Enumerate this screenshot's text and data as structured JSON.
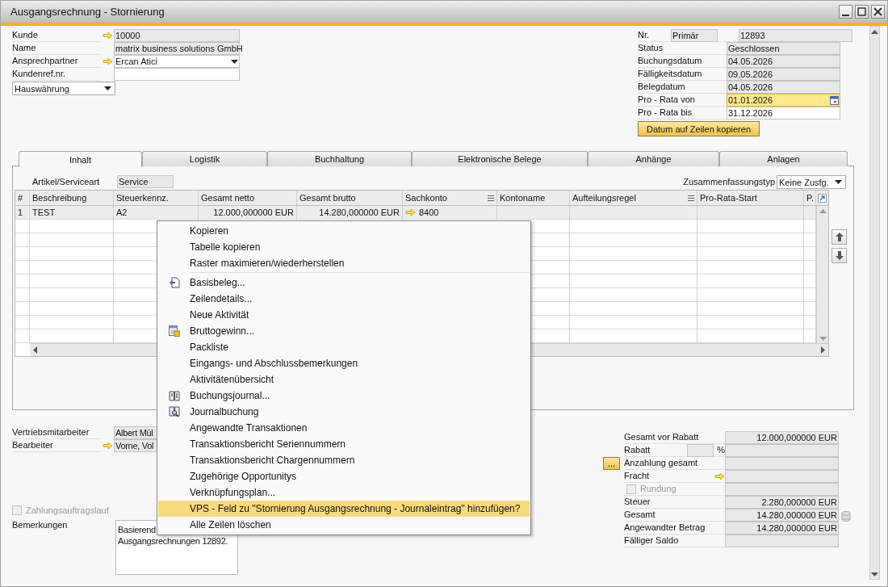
{
  "window": {
    "title": "Ausgangsrechnung - Stornierung"
  },
  "header_left": {
    "fields": [
      {
        "label": "Kunde",
        "value": "10000",
        "kind": "link",
        "editable": false
      },
      {
        "label": "Name",
        "value": "matrix business solutions GmbH",
        "kind": "plain",
        "editable": false
      },
      {
        "label": "Ansprechpartner",
        "value": "Ercan Atici",
        "kind": "link-dropdown",
        "editable": true
      },
      {
        "label": "Kundenref.nr.",
        "kind": "plain",
        "editable": true
      }
    ],
    "currency": {
      "value": "Hauswährung"
    }
  },
  "header_right": {
    "fields": [
      {
        "label": "Nr.",
        "series": "Primär",
        "value": "12893",
        "kind": "series",
        "editable": false,
        "focused": false
      },
      {
        "label": "Status",
        "value": "Geschlossen",
        "kind": "plain",
        "editable": false,
        "focused": false
      },
      {
        "label": "Buchungsdatum",
        "value": "04.05.2026",
        "kind": "plain",
        "editable": false,
        "focused": false
      },
      {
        "label": "Fälligkeitsdatum",
        "value": "09.05.2026",
        "kind": "plain",
        "editable": false,
        "focused": false
      },
      {
        "label": "Belegdatum",
        "value": "04.05.2026",
        "kind": "plain",
        "editable": false,
        "focused": false
      },
      {
        "label": "Pro - Rata von",
        "value": "01.01.2026",
        "kind": "date",
        "editable": true,
        "focused": true
      },
      {
        "label": "Pro - Rata bis",
        "value": "31.12.2026",
        "kind": "plain",
        "editable": true,
        "focused": false
      }
    ],
    "button": "Datum auf Zeilen kopieren"
  },
  "tabs": [
    {
      "label": "Inhalt",
      "selected": true
    },
    {
      "label": "Logistik",
      "selected": false
    },
    {
      "label": "Buchhaltung",
      "selected": false
    },
    {
      "label": "Elektronische Belege",
      "selected": false
    },
    {
      "label": "Anhänge",
      "selected": false
    },
    {
      "label": "Anlagen",
      "selected": false
    }
  ],
  "item_type": {
    "label": "Artikel/Serviceart",
    "value": "Service"
  },
  "summary_type": {
    "label": "Zusammenfassungstyp",
    "value": "Keine Zusfg."
  },
  "table": {
    "columns": [
      {
        "label": "#",
        "kind": "text"
      },
      {
        "label": "Beschreibung",
        "kind": "text"
      },
      {
        "label": "Steuerkennz.",
        "kind": "text"
      },
      {
        "label": "Gesamt netto",
        "kind": "amount"
      },
      {
        "label": "Gesamt brutto",
        "kind": "amount"
      },
      {
        "label": "Sachkonto",
        "kind": "account",
        "menu": true
      },
      {
        "label": "Kontoname",
        "kind": "text"
      },
      {
        "label": "Aufteilungsregel",
        "kind": "text",
        "menu": true
      },
      {
        "label": "Pro-Rata-Start",
        "kind": "text"
      },
      {
        "label": "P.",
        "kind": "text"
      }
    ],
    "rows": [
      {
        "cells": [
          "1",
          "TEST",
          "A2",
          "12.000,000000 EUR",
          "14.280,000000 EUR",
          "8400"
        ]
      }
    ]
  },
  "context_menu": {
    "sections": [
      [
        {
          "label": "Kopieren",
          "kind": "plain",
          "selected": false
        },
        {
          "label": "Tabelle kopieren",
          "kind": "plain",
          "selected": false
        },
        {
          "label": "Raster maximieren/wiederherstellen",
          "kind": "plain",
          "selected": false
        }
      ],
      [
        {
          "label": "Basisbeleg...",
          "kind": "icon",
          "selected": false
        },
        {
          "label": "Zeilendetails...",
          "kind": "plain",
          "selected": false
        },
        {
          "label": "Neue Aktivität",
          "kind": "plain",
          "selected": false
        },
        {
          "label": "Bruttogewinn...",
          "kind": "icon",
          "selected": false
        },
        {
          "label": "Packliste",
          "kind": "plain",
          "selected": false
        },
        {
          "label": "Eingangs- und Abschlussbemerkungen",
          "kind": "plain",
          "selected": false
        },
        {
          "label": "Aktivitätenübersicht",
          "kind": "plain",
          "selected": false
        },
        {
          "label": "Buchungsjournal...",
          "kind": "icon",
          "selected": false
        },
        {
          "label": "Journalbuchung",
          "kind": "icon",
          "selected": false
        },
        {
          "label": "Angewandte Transaktionen",
          "kind": "plain",
          "selected": false
        },
        {
          "label": "Transaktionsbericht Seriennummern",
          "kind": "plain",
          "selected": false
        },
        {
          "label": "Transaktionsbericht Chargennummern",
          "kind": "plain",
          "selected": false
        },
        {
          "label": "Zugehörige Opportunitys",
          "kind": "plain",
          "selected": false
        },
        {
          "label": "Verknüpfungsplan...",
          "kind": "plain",
          "selected": false
        },
        {
          "label": "VPS - Feld zu \"Stornierung Ausgangsrechnung - Journaleintrag\" hinzufügen?",
          "kind": "plain",
          "selected": true
        },
        {
          "label": "Alle Zeilen löschen",
          "kind": "plain",
          "selected": false
        }
      ]
    ]
  },
  "bottom_left": {
    "fields": [
      {
        "label": "Vertriebsmitarbeiter",
        "value": "Albert Mül",
        "kind": "plain"
      },
      {
        "label": "Bearbeiter",
        "value": "Vorne, Vol",
        "kind": "link"
      }
    ],
    "payment_run": {
      "label": "Zahlungsauftragslauf",
      "checked": false,
      "disabled": true
    },
    "remarks": {
      "label": "Bemerkungen",
      "value": "Basierend\nAusgangsrechnungen 12892."
    }
  },
  "totals": [
    {
      "label": "Gesamt vor Rabatt",
      "value": "12.000,000000 EUR",
      "kind": "plain"
    },
    {
      "label": "Rabatt",
      "unit": "%",
      "kind": "percent"
    },
    {
      "label": "Anzahlung gesamt",
      "button": "...",
      "kind": "downpayment"
    },
    {
      "label": "Fracht",
      "kind": "link"
    },
    {
      "label": "Rundung",
      "kind": "checkbox",
      "checked": false,
      "disabled": true
    },
    {
      "label": "Steuer",
      "value": "2.280,000000 EUR",
      "kind": "plain"
    },
    {
      "label": "Gesamt",
      "value": "14.280,000000 EUR",
      "kind": "total"
    },
    {
      "label": "Angewandter Betrag",
      "value": "14.280,000000 EUR",
      "kind": "plain"
    },
    {
      "label": "Fälliger Saldo",
      "kind": "plain"
    }
  ]
}
